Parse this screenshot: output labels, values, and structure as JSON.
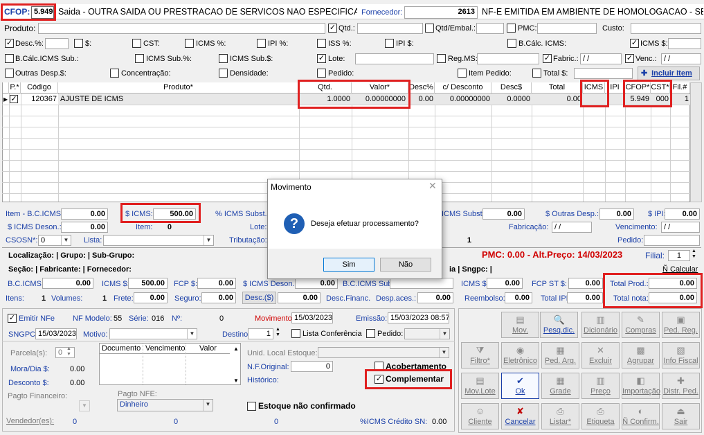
{
  "top": {
    "cfop_label": "CFOP:",
    "cfop_value": "5.949",
    "description": "Saida - OUTRA SAIDA OU PRESTRACAO DE SERVICOS NAO ESPECIFICADOS",
    "fornecedor_label": "Fornecedor:",
    "fornecedor_value": "2613",
    "nfe_text": "NF-E EMITIDA EM AMBIENTE DE HOMOLOGACAO - SEM V"
  },
  "filters": {
    "produto": "Produto:",
    "qtd": "Qtd.:",
    "qtd_embal": "Qtd/Embal.:",
    "pmc": "PMC:",
    "custo": "Custo:",
    "desc_pct": "Desc.%:",
    "dollar": "$:",
    "cst": "CST:",
    "icms_pct": "ICMS %:",
    "ipi_pct": "IPI %:",
    "iss_pct": "ISS %:",
    "ipi_dollar": "IPI $:",
    "bcalc_icms": "B.Cálc. ICMS:",
    "icms_dollar": "ICMS $:",
    "bcalc_icms_sub": "B.Cálc.ICMS Sub.:",
    "icms_sub_pct": "ICMS Sub.%:",
    "icms_sub_dollar": "ICMS Sub.$:",
    "lote": "Lote:",
    "reg_ms": "Reg.MS:",
    "fabric": "Fabric.:",
    "fabric_value": "/ /",
    "venc": "Venc.:",
    "venc_value": "/ /",
    "outras_desp": "Outras Desp.$:",
    "concentracao": "Concentração:",
    "densidade": "Densidade:",
    "pedido": "Pedido:",
    "item_pedido": "Item Pedido:",
    "total_dollar": "Total $:",
    "incluir_item": "Incluir Item"
  },
  "grid": {
    "columns": [
      "P.*",
      "Código",
      "Produto*",
      "Qtd.",
      "Valor*",
      "Desc%",
      "c/ Desconto",
      "Desc$",
      "Total",
      "ICMS",
      "IPI",
      "CFOP*",
      "CST*",
      "Fil.#"
    ],
    "rows": [
      {
        "p": "✓",
        "codigo": "120367",
        "produto": "AJUSTE DE ICMS",
        "qtd": "1.0000",
        "valor": "0.00000000",
        "desc_pct": "0.00",
        "c_desconto": "0.00000000",
        "desc_dollar": "0.0000",
        "total": "0.00",
        "icms": "",
        "ipi": "",
        "cfop": "5.949",
        "cst": "000",
        "fil": "1"
      }
    ]
  },
  "item_panel": {
    "bc_icms_label": "Item - B.C.ICMS:",
    "bc_icms": "0.00",
    "icms_label": "$ ICMS:",
    "icms": "500.00",
    "pct_icms_subst": "% ICMS Subst.:",
    "icms_subst_label": "ICMS Subst.:",
    "icms_subst": "0.00",
    "outras_desp_label": "$ Outras Desp.:",
    "outras_desp": "0.00",
    "ipi_label": "$ IPI:",
    "ipi": "0.00",
    "icms_deson_label": "$ ICMS Deson.:",
    "icms_deson": "0.00",
    "item_label": "Item:",
    "item": "0",
    "lote_label": "Lote:",
    "fabricacao_label": "Fabricação:",
    "fabricacao": "/ /",
    "vencimento_label": "Vencimento:",
    "vencimento": "/ /",
    "csosn_label": "CSOSN*:",
    "csosn": "0",
    "lista_label": "Lista:",
    "tributacao_label": "Tributação:",
    "tributacao_value": "1",
    "pedido_label": "Pedido:"
  },
  "info": {
    "localizacao": "Localização: | Grupo: | Sub-Grupo:",
    "pmc": "PMC: 0.00 - Alt.Preço: 14/03/2023",
    "filial_label": "Filial:",
    "filial": "1",
    "secao": "Seção: | Fabricante: | Fornecedor:",
    "ia_singpc": "ia | Sngpc: |",
    "calcular": "Ñ Calcular"
  },
  "totals": {
    "bc_icms_label": "B.C.ICMS:",
    "bc_icms": "0.00",
    "icms_label": "ICMS $:",
    "icms": "500.00",
    "fcp_label": "FCP $:",
    "fcp": "0.00",
    "icms_deson_label": "$ ICMS Deson.:",
    "icms_deson": "0.00",
    "bc_icms_sub_label": "B.C.ICMS Sub",
    "icms2_label": "ICMS $:",
    "icms2": "0.00",
    "fcp_st_label": "FCP ST $:",
    "fcp_st": "0.00",
    "total_prod_label": "Total Prod.:",
    "total_prod": "0.00",
    "itens_label": "Itens:",
    "itens": "1",
    "volumes_label": "Volumes:",
    "volumes": "1",
    "frete_label": "Frete:",
    "frete": "0.00",
    "seguro_label": "Seguro:",
    "seguro": "0.00",
    "desc_label": "Desc.($)",
    "desc": "0.00",
    "desc_financ_label": "Desc.Financ.",
    "desp_aces_label": "Desp.aces.:",
    "desp_aces": "0.00",
    "reembolso_label": "Reembolso:",
    "reembolso": "0.00",
    "total_ipi_label": "Total IPI:",
    "total_ipi": "0.00",
    "total_nota_label": "Total nota:",
    "total_nota": "0.00"
  },
  "bottom": {
    "emitir_nfe": "Emitir NFe",
    "nf_modelo_label": "NF Modelo:",
    "nf_modelo": "55",
    "serie_label": "Série:",
    "serie": "016",
    "n_label": "Nº:",
    "n": "0",
    "movimento_label": "Movimento",
    "movimento": "15/03/2023",
    "emissao_label": "Emissão:",
    "emissao": "15/03/2023 08:57",
    "sngpc_label": "SNGPC:",
    "sngpc": "15/03/2023",
    "motivo_label": "Motivo:",
    "destino_label": "Destino:",
    "destino": "1",
    "lista_conf": "Lista Conferência",
    "pedido_cb": "Pedido:",
    "parcelas_label": "Parcela(s):",
    "parcelas": "0",
    "doc_cols": [
      "Documento",
      "Vencimento",
      "Valor"
    ],
    "unid_estoque": "Unid. Local Estoque:",
    "nf_original_label": "N.F.Original:",
    "nf_original": "0",
    "acobertamento": "Acobertamento",
    "historico": "Histórico:",
    "complementar": "Complementar",
    "mora_label": "Mora/Dia $:",
    "mora": "0.00",
    "desconto_label": "Desconto $:",
    "desconto": "0.00",
    "pagto_financeiro": "Pagto Financeiro:",
    "pagto_nfe_label": "Pagto NFE:",
    "pagto_nfe": "Dinheiro",
    "estoque_nc": "Estoque não confirmado",
    "vendedores_label": "Vendedor(es):",
    "v1": "0",
    "v2": "0",
    "v3": "0",
    "icms_credito_label": "%ICMS Crédito SN:",
    "icms_credito": "0.00"
  },
  "toolbar": [
    {
      "label": "Mov.",
      "icon": "▤"
    },
    {
      "label": "Pesq.dic.",
      "icon": "🔍"
    },
    {
      "label": "Dicionário",
      "icon": "▥"
    },
    {
      "label": "Compras",
      "icon": "✎"
    },
    {
      "label": "Ped. Reg.",
      "icon": "▣"
    },
    {
      "label": "Filtro*",
      "icon": "⧩"
    },
    {
      "label": "Eletrônico",
      "icon": "◉"
    },
    {
      "label": "Ped. Arq.",
      "icon": "▦"
    },
    {
      "label": "Excluir",
      "icon": "✕"
    },
    {
      "label": "Agrupar",
      "icon": "▩"
    },
    {
      "label": "Info Fiscal",
      "icon": "▧"
    },
    {
      "label": "Mov.Lote",
      "icon": "▤"
    },
    {
      "label": "Ok",
      "icon": "✔"
    },
    {
      "label": "Grade",
      "icon": "▦"
    },
    {
      "label": "Preço",
      "icon": "▥"
    },
    {
      "label": "Importação",
      "icon": "◧"
    },
    {
      "label": "Distr. Ped.",
      "icon": "✚"
    },
    {
      "label": "Cliente",
      "icon": "☺"
    },
    {
      "label": "Cancelar",
      "icon": "✘"
    },
    {
      "label": "Listar*",
      "icon": "⎙"
    },
    {
      "label": "Etiqueta",
      "icon": "⎙"
    },
    {
      "label": "Ñ Confirm.",
      "icon": "◐"
    },
    {
      "label": "Sair",
      "icon": "⏏"
    }
  ],
  "dialog": {
    "title": "Movimento",
    "message": "Deseja efetuar processamento?",
    "yes": "Sim",
    "no": "Não"
  }
}
